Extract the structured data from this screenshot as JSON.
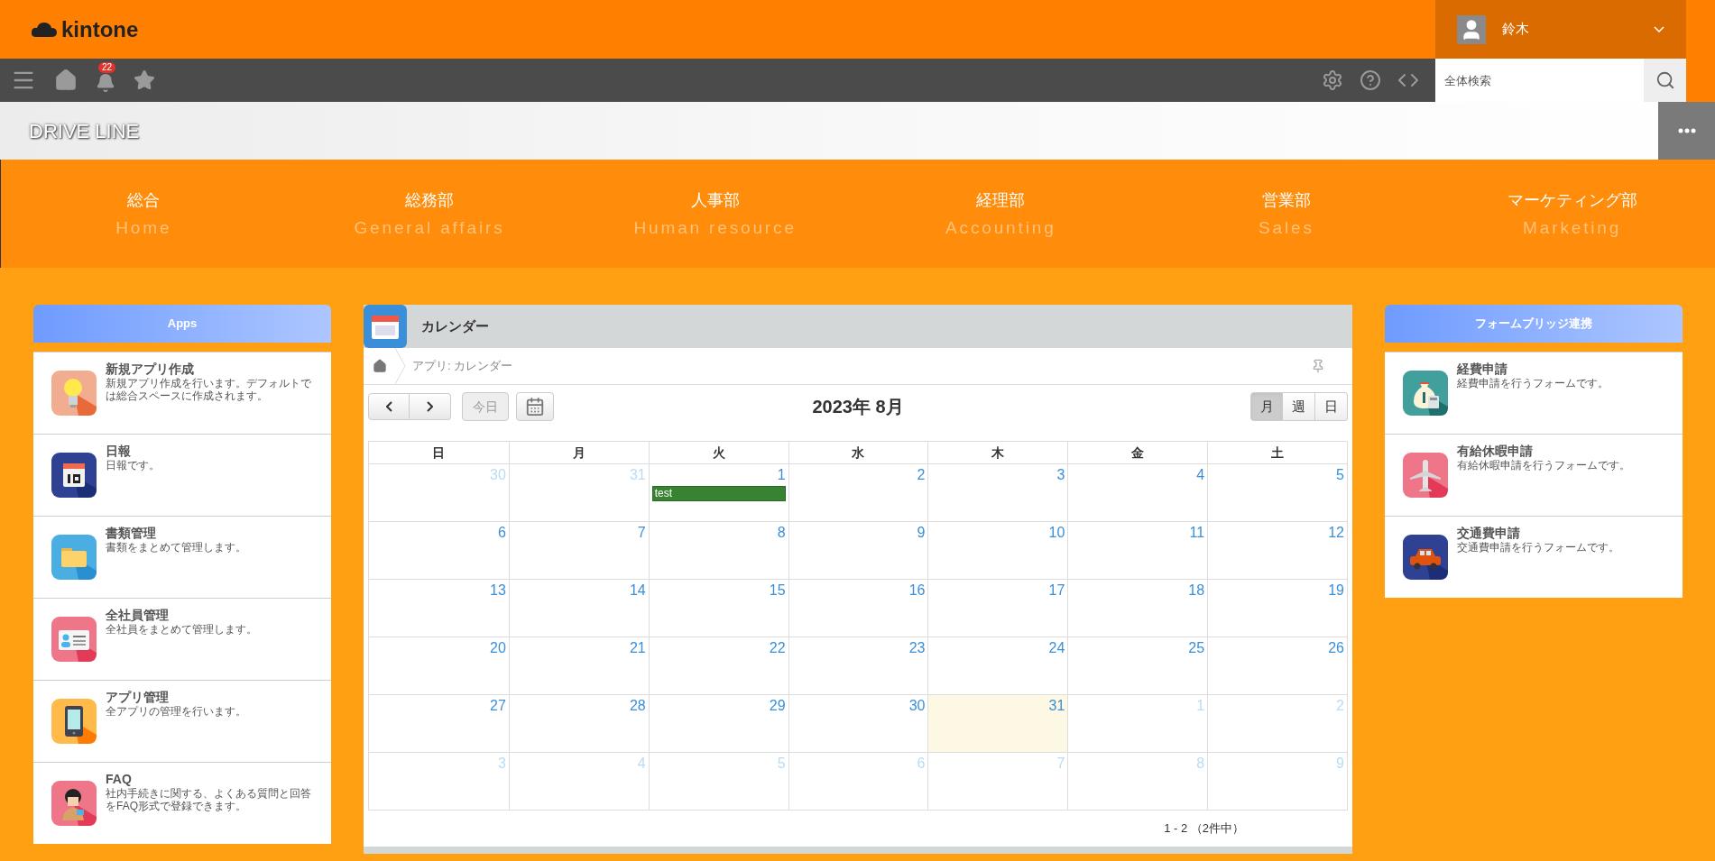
{
  "header": {
    "logo": "kintone",
    "user": "鈴木"
  },
  "toolbar": {
    "notification_count": "22",
    "search": {
      "placeholder": "全体検索"
    }
  },
  "space": {
    "title": "DRIVE LINE"
  },
  "nav": [
    {
      "label": "総合",
      "sublabel": "Home"
    },
    {
      "label": "総務部",
      "sublabel": "General affairs"
    },
    {
      "label": "人事部",
      "sublabel": "Human resource"
    },
    {
      "label": "経理部",
      "sublabel": "Accounting"
    },
    {
      "label": "営業部",
      "sublabel": "Sales"
    },
    {
      "label": "マーケティング部",
      "sublabel": "Marketing"
    }
  ],
  "apps_panel": {
    "title": "Apps",
    "items": [
      {
        "name": "新規アプリ作成",
        "description": "新規アプリ作成を行います。デフォルトでは総合スペースに作成されます。"
      },
      {
        "name": "日報",
        "description": "日報です。"
      },
      {
        "name": "書類管理",
        "description": "書類をまとめて管理します。"
      },
      {
        "name": "全社員管理",
        "description": "全社員をまとめて管理します。"
      },
      {
        "name": "アプリ管理",
        "description": "全アプリの管理を行います。"
      },
      {
        "name": "FAQ",
        "description": "社内手続きに関する、よくある質問と回答をFAQ形式で登録できます。"
      }
    ]
  },
  "calendar": {
    "title": "カレンダー",
    "breadcrumb": "アプリ: カレンダー",
    "today_button": "今日",
    "month": "2023年 8月",
    "views": [
      {
        "label": "月",
        "selected": true
      },
      {
        "label": "週",
        "selected": false
      },
      {
        "label": "日",
        "selected": false
      }
    ],
    "weekdays": [
      "日",
      "月",
      "火",
      "水",
      "木",
      "金",
      "土"
    ],
    "weeks": [
      [
        {
          "day": "30",
          "other_month": true,
          "today": false
        },
        {
          "day": "31",
          "other_month": true,
          "today": false
        },
        {
          "day": "1",
          "other_month": false,
          "today": false,
          "events": [
            "test"
          ]
        },
        {
          "day": "2",
          "other_month": false,
          "today": false
        },
        {
          "day": "3",
          "other_month": false,
          "today": false
        },
        {
          "day": "4",
          "other_month": false,
          "today": false
        },
        {
          "day": "5",
          "other_month": false,
          "today": false
        }
      ],
      [
        {
          "day": "6",
          "other_month": false,
          "today": false
        },
        {
          "day": "7",
          "other_month": false,
          "today": false
        },
        {
          "day": "8",
          "other_month": false,
          "today": false
        },
        {
          "day": "9",
          "other_month": false,
          "today": false
        },
        {
          "day": "10",
          "other_month": false,
          "today": false
        },
        {
          "day": "11",
          "other_month": false,
          "today": false
        },
        {
          "day": "12",
          "other_month": false,
          "today": false
        }
      ],
      [
        {
          "day": "13",
          "other_month": false,
          "today": false
        },
        {
          "day": "14",
          "other_month": false,
          "today": false
        },
        {
          "day": "15",
          "other_month": false,
          "today": false
        },
        {
          "day": "16",
          "other_month": false,
          "today": false
        },
        {
          "day": "17",
          "other_month": false,
          "today": false
        },
        {
          "day": "18",
          "other_month": false,
          "today": false
        },
        {
          "day": "19",
          "other_month": false,
          "today": false
        }
      ],
      [
        {
          "day": "20",
          "other_month": false,
          "today": false
        },
        {
          "day": "21",
          "other_month": false,
          "today": false
        },
        {
          "day": "22",
          "other_month": false,
          "today": false
        },
        {
          "day": "23",
          "other_month": false,
          "today": false
        },
        {
          "day": "24",
          "other_month": false,
          "today": false
        },
        {
          "day": "25",
          "other_month": false,
          "today": false
        },
        {
          "day": "26",
          "other_month": false,
          "today": false
        }
      ],
      [
        {
          "day": "27",
          "other_month": false,
          "today": false
        },
        {
          "day": "28",
          "other_month": false,
          "today": false
        },
        {
          "day": "29",
          "other_month": false,
          "today": false
        },
        {
          "day": "30",
          "other_month": false,
          "today": false
        },
        {
          "day": "31",
          "other_month": false,
          "today": true
        },
        {
          "day": "1",
          "other_month": true,
          "today": false
        },
        {
          "day": "2",
          "other_month": true,
          "today": false
        }
      ],
      [
        {
          "day": "3",
          "other_month": true,
          "today": false
        },
        {
          "day": "4",
          "other_month": true,
          "today": false
        },
        {
          "day": "5",
          "other_month": true,
          "today": false
        },
        {
          "day": "6",
          "other_month": true,
          "today": false
        },
        {
          "day": "7",
          "other_month": true,
          "today": false
        },
        {
          "day": "8",
          "other_month": true,
          "today": false
        },
        {
          "day": "9",
          "other_month": true,
          "today": false
        }
      ]
    ],
    "footer": "1 - 2 （2件中）"
  },
  "form_panel": {
    "title": "フォームブリッジ連携",
    "items": [
      {
        "name": "経費申請",
        "description": "経費申請を行うフォームです。"
      },
      {
        "name": "有給休暇申請",
        "description": "有給休暇申請を行うフォームです。"
      },
      {
        "name": "交通費申請",
        "description": "交通費申請を行うフォームです。"
      }
    ]
  }
}
